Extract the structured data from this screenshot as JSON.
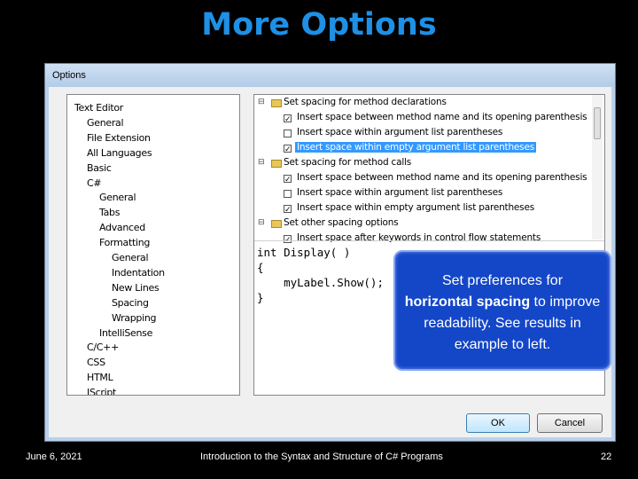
{
  "slide": {
    "title": "More Options",
    "footer_date": "June 6, 2021",
    "footer_center": "Introduction to the Syntax and Structure of C# Programs",
    "footer_page": "22"
  },
  "dialog": {
    "title": "Options",
    "tree": [
      {
        "label": "Text Editor",
        "level": 0
      },
      {
        "label": "General",
        "level": 1
      },
      {
        "label": "File Extension",
        "level": 1
      },
      {
        "label": "All Languages",
        "level": 1
      },
      {
        "label": "Basic",
        "level": 1
      },
      {
        "label": "C#",
        "level": 1
      },
      {
        "label": "General",
        "level": 2
      },
      {
        "label": "Tabs",
        "level": 2
      },
      {
        "label": "Advanced",
        "level": 2
      },
      {
        "label": "Formatting",
        "level": 2
      },
      {
        "label": "General",
        "level": 3
      },
      {
        "label": "Indentation",
        "level": 3
      },
      {
        "label": "New Lines",
        "level": 3
      },
      {
        "label": "Spacing",
        "level": 3
      },
      {
        "label": "Wrapping",
        "level": 3
      },
      {
        "label": "IntelliSense",
        "level": 2
      },
      {
        "label": "C/C++",
        "level": 1
      },
      {
        "label": "CSS",
        "level": 1
      },
      {
        "label": "HTML",
        "level": 1
      },
      {
        "label": "JScript",
        "level": 1
      }
    ],
    "options": [
      {
        "label": "Set spacing for method declarations",
        "type": "group"
      },
      {
        "label": "Insert space between method name and its opening parenthesis",
        "type": "check",
        "checked": true
      },
      {
        "label": "Insert space within argument list parentheses",
        "type": "check",
        "checked": false
      },
      {
        "label": "Insert space within empty argument list parentheses",
        "type": "check",
        "checked": true,
        "selected": true
      },
      {
        "label": "Set spacing for method calls",
        "type": "group"
      },
      {
        "label": "Insert space between method name and its opening parenthesis",
        "type": "check",
        "checked": true
      },
      {
        "label": "Insert space within argument list parentheses",
        "type": "check",
        "checked": false
      },
      {
        "label": "Insert space within empty argument list parentheses",
        "type": "check",
        "checked": true
      },
      {
        "label": "Set other spacing options",
        "type": "group"
      },
      {
        "label": "Insert space after keywords in control flow statements",
        "type": "check",
        "checked": true
      }
    ],
    "code": {
      "line1": "int Display( )",
      "line2": "{",
      "line3": "    myLabel.Show();",
      "line4": "}"
    },
    "ok_label": "OK",
    "cancel_label": "Cancel"
  },
  "callout": {
    "text_before": "Set preferences for",
    "text_bold": "horizontal spacing",
    "text_after": "to improve readability.  See results in example to left."
  }
}
